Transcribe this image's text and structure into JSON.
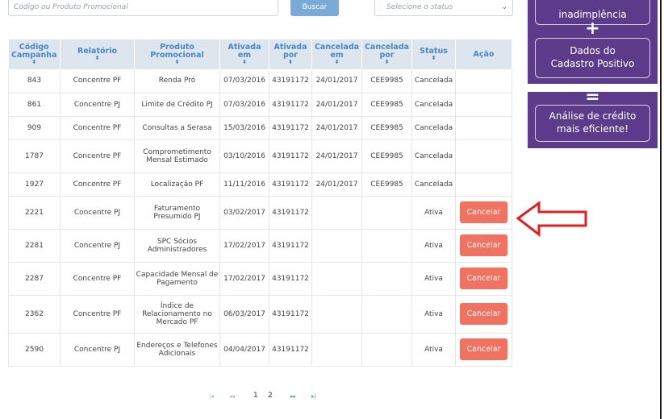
{
  "search": {
    "placeholder": "Código ou Produto Promocional",
    "button_label": "Buscar",
    "status_placeholder": "Selecione o status"
  },
  "table": {
    "headers": {
      "codigo": "Código Campanha",
      "relatorio": "Relatório",
      "produto": "Produto Promocional",
      "ativada_em": "Ativada em",
      "ativada_por": "Ativada por",
      "cancelada_em": "Cancelada em",
      "cancelada_por": "Cancelada por",
      "status": "Status",
      "acao": "Ação"
    },
    "sort_icon": "⬍",
    "cancel_label": "Cancelar",
    "rows": [
      {
        "codigo": "843",
        "relatorio": "Concentre PF",
        "produto": "Renda Pró",
        "ativada_em": "07/03/2016",
        "ativada_por": "43191172",
        "cancelada_em": "24/01/2017",
        "cancelada_por": "CEE9985",
        "status": "Cancelada"
      },
      {
        "codigo": "861",
        "relatorio": "Concentre PJ",
        "produto": "Limite de Crédito PJ",
        "ativada_em": "07/03/2016",
        "ativada_por": "43191172",
        "cancelada_em": "24/01/2017",
        "cancelada_por": "CEE9985",
        "status": "Cancelada"
      },
      {
        "codigo": "909",
        "relatorio": "Concentre PF",
        "produto": "Consultas a Serasa",
        "ativada_em": "15/03/2016",
        "ativada_por": "43191172",
        "cancelada_em": "24/01/2017",
        "cancelada_por": "CEE9985",
        "status": "Cancelada"
      },
      {
        "codigo": "1787",
        "relatorio": "Concentre PF",
        "produto": "Comprometimento Mensal Estimado",
        "ativada_em": "03/10/2016",
        "ativada_por": "43191172",
        "cancelada_em": "24/01/2017",
        "cancelada_por": "CEE9985",
        "status": "Cancelada"
      },
      {
        "codigo": "1927",
        "relatorio": "Concentre PF",
        "produto": "Localização PF",
        "ativada_em": "11/11/2016",
        "ativada_por": "43191172",
        "cancelada_em": "24/01/2017",
        "cancelada_por": "CEE9985",
        "status": "Cancelada"
      },
      {
        "codigo": "2221",
        "relatorio": "Concentre PJ",
        "produto": "Faturamento Presumido PJ",
        "ativada_em": "03/02/2017",
        "ativada_por": "43191172",
        "cancelada_em": "",
        "cancelada_por": "",
        "status": "Ativa"
      },
      {
        "codigo": "2281",
        "relatorio": "Concentre PJ",
        "produto": "SPC Sócios Administradores",
        "ativada_em": "17/02/2017",
        "ativada_por": "43191172",
        "cancelada_em": "",
        "cancelada_por": "",
        "status": "Ativa"
      },
      {
        "codigo": "2287",
        "relatorio": "Concentre PF",
        "produto": "Capacidade Mensal de Pagamento",
        "ativada_em": "17/02/2017",
        "ativada_por": "43191172",
        "cancelada_em": "",
        "cancelada_por": "",
        "status": "Ativa"
      },
      {
        "codigo": "2362",
        "relatorio": "Concentre PF",
        "produto": "Índice de Relacionamento no Mercado PF",
        "ativada_em": "06/03/2017",
        "ativada_por": "43191172",
        "cancelada_em": "",
        "cancelada_por": "",
        "status": "Ativa"
      },
      {
        "codigo": "2590",
        "relatorio": "Concentre PJ",
        "produto": "Endereços e Telefones Adicionais",
        "ativada_em": "04/04/2017",
        "ativada_por": "43191172",
        "cancelada_em": "",
        "cancelada_por": "",
        "status": "Ativa"
      }
    ]
  },
  "pagination": {
    "first": "|◂",
    "prev": "◂◂",
    "pages": [
      "1",
      "2"
    ],
    "next": "▸▸",
    "last": "▸|"
  },
  "promo": {
    "card1_line1": "inadimplência",
    "card2_line1": "Dados do",
    "card2_line2": "Cadastro Positivo",
    "card3_line1": "Análise de crédito",
    "card3_line2": "mais eficiente!",
    "plus_symbol": "+",
    "equals_symbol": "="
  },
  "colors": {
    "header_bg": "#dde6ef",
    "header_text": "#4a87c5",
    "cancel_button": "#f07362",
    "promo_bg": "#5b3b8a",
    "arrow": "#e02020"
  }
}
